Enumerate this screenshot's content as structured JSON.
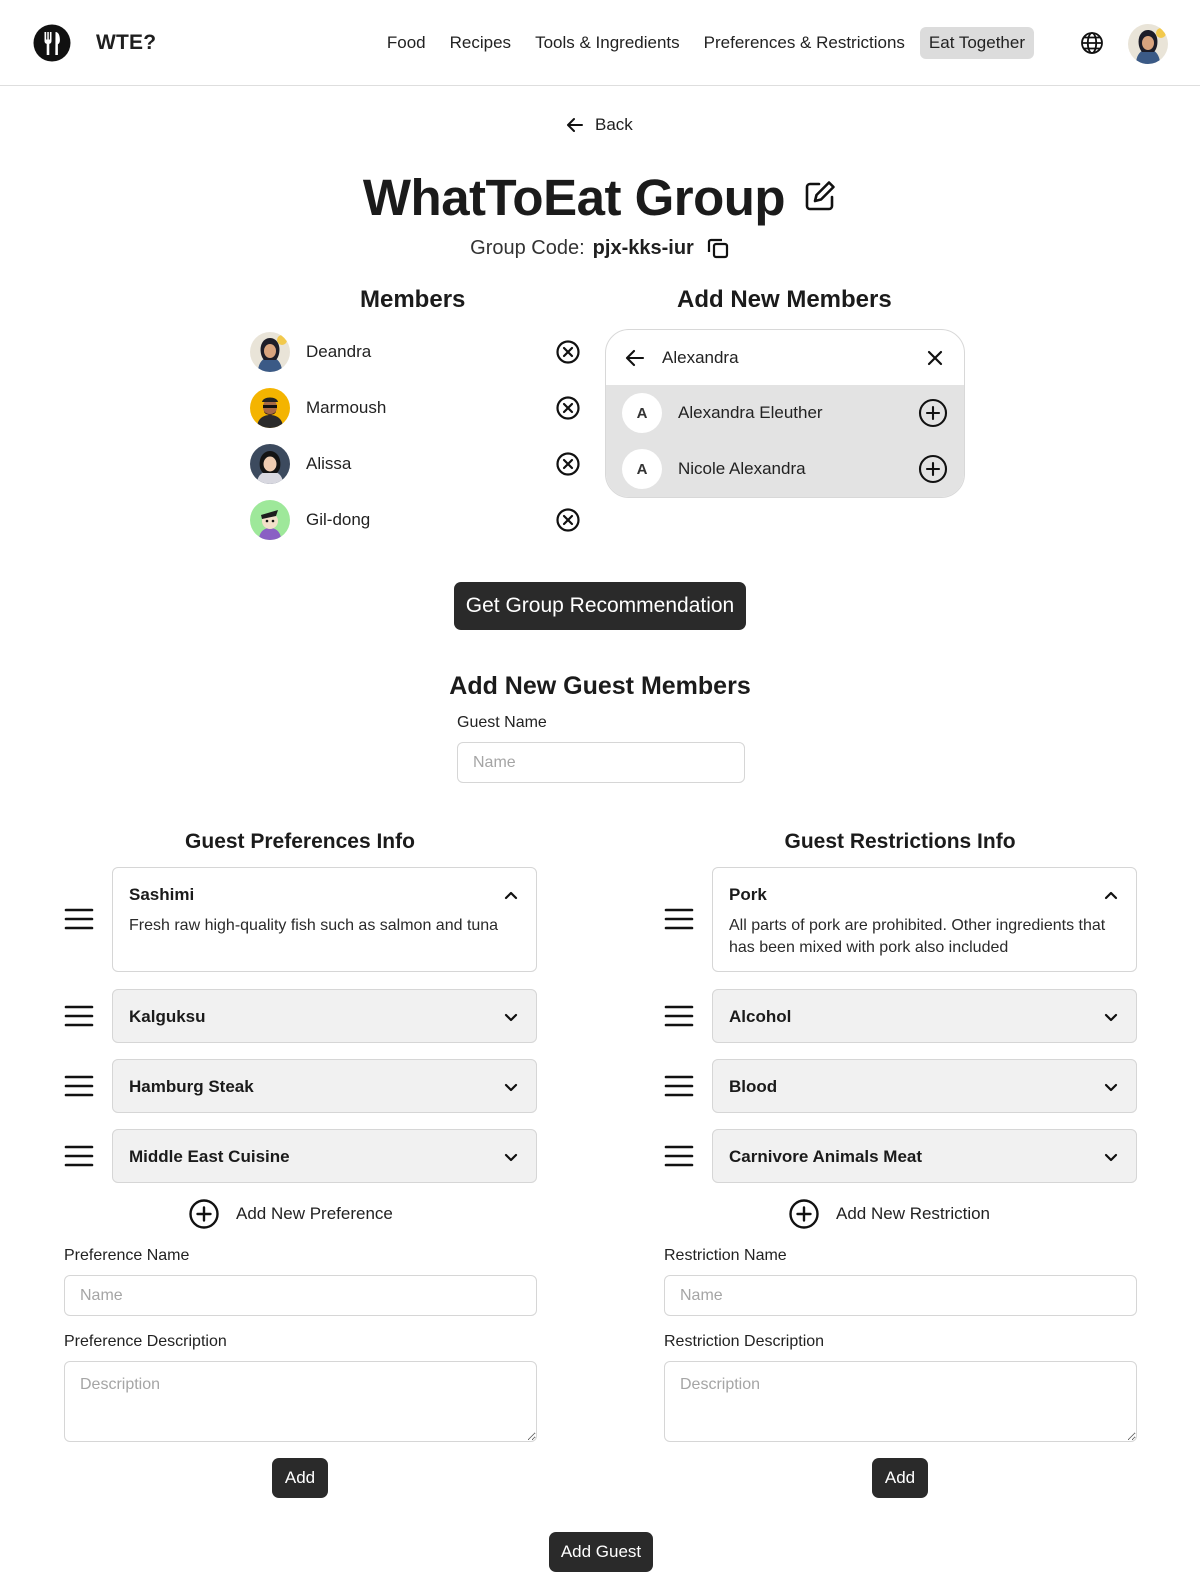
{
  "header": {
    "brand": "WTE?",
    "nav": [
      {
        "label": "Food"
      },
      {
        "label": "Recipes"
      },
      {
        "label": "Tools & Ingredients"
      },
      {
        "label": "Preferences & Restrictions"
      },
      {
        "label": "Eat Together",
        "active": true
      }
    ],
    "icons": [
      "logo-icon",
      "globe-icon",
      "user-avatar"
    ]
  },
  "back_label": "Back",
  "group": {
    "title": "WhatToEat Group",
    "code_label": "Group Code:",
    "code": "pjx-kks-iur"
  },
  "members": {
    "title": "Members",
    "items": [
      {
        "name": "Deandra"
      },
      {
        "name": "Marmoush"
      },
      {
        "name": "Alissa"
      },
      {
        "name": "Gil-dong"
      }
    ]
  },
  "add_members": {
    "title": "Add New Members",
    "search_value": "Alexandra",
    "results": [
      {
        "initial": "A",
        "name": "Alexandra Eleuther"
      },
      {
        "initial": "A",
        "name": "Nicole Alexandra"
      }
    ]
  },
  "recommend_button": "Get Group Recommendation",
  "guest": {
    "title": "Add New Guest Members",
    "name_label": "Guest Name",
    "name_placeholder": "Name",
    "add_button": "Add Guest"
  },
  "preferences": {
    "title": "Guest Preferences Info",
    "items": [
      {
        "name": "Sashimi",
        "description": "Fresh raw high-quality fish such as salmon and tuna",
        "expanded": true
      },
      {
        "name": "Kalguksu",
        "expanded": false
      },
      {
        "name": "Hamburg Steak",
        "expanded": false
      },
      {
        "name": "Middle East Cuisine",
        "expanded": false
      }
    ],
    "add_new": "Add New Preference",
    "name_label": "Preference Name",
    "name_placeholder": "Name",
    "desc_label": "Preference Description",
    "desc_placeholder": "Description",
    "add_button": "Add"
  },
  "restrictions": {
    "title": "Guest Restrictions Info",
    "items": [
      {
        "name": "Pork",
        "description": "All parts of pork are prohibited. Other ingredients that has been mixed with pork also included",
        "expanded": true
      },
      {
        "name": "Alcohol",
        "expanded": false
      },
      {
        "name": "Blood",
        "expanded": false
      },
      {
        "name": "Carnivore Animals Meat",
        "expanded": false
      }
    ],
    "add_new": "Add New Restriction",
    "name_label": "Restriction Name",
    "name_placeholder": "Name",
    "desc_label": "Restriction Description",
    "desc_placeholder": "Description",
    "add_button": "Add"
  },
  "colors": {
    "dark_button": "#2a2a2a",
    "active_nav": "#dcdcdc",
    "search_results_bg": "#e3e3e3",
    "collapsed_card_bg": "#f1f1f1"
  }
}
